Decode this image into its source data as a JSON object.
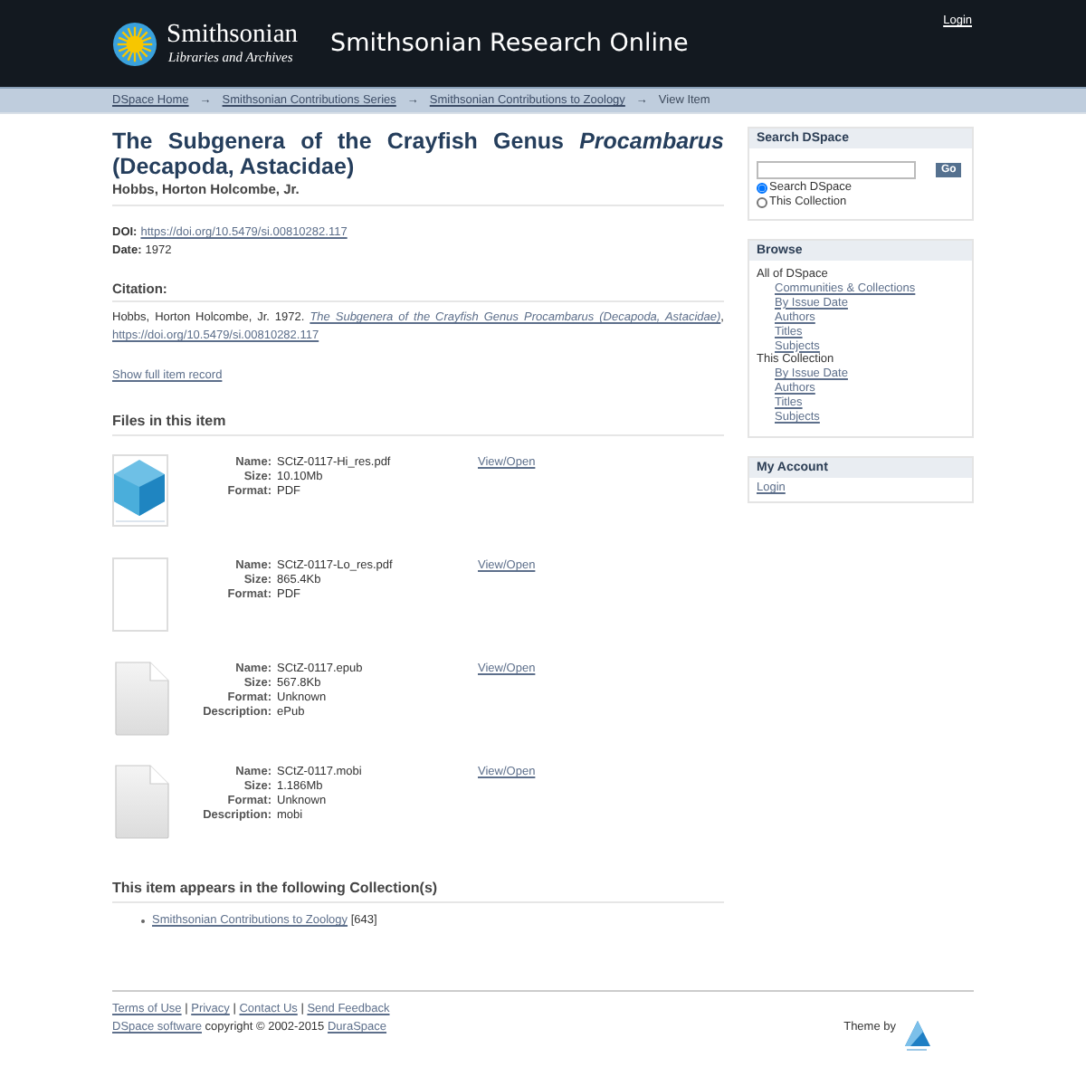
{
  "header": {
    "logo_name": "Smithsonian",
    "logo_subtitle": "Libraries and Archives",
    "site_title": "Smithsonian Research Online",
    "login": "Login"
  },
  "breadcrumbs": [
    {
      "label": "DSpace Home",
      "link": true
    },
    {
      "label": "Smithsonian Contributions Series",
      "link": true,
      "separator": "→"
    },
    {
      "label": "Smithsonian Contributions to Zoology",
      "link": true,
      "separator": "→"
    },
    {
      "label": "View Item",
      "link": false,
      "separator": "→"
    }
  ],
  "item": {
    "title": "The Subgenera of the Crayfish Genus *Procambarus* (Decapoda, Astacidae)",
    "author": "Hobbs, Horton Holcombe, Jr.",
    "fields": [
      {
        "label": "DOI:",
        "value": "https://doi.org/10.5479/si.00810282.117",
        "kind": "link"
      },
      {
        "label": "Date:",
        "value": "1972",
        "kind": "text"
      }
    ],
    "citation_heading": "Citation:",
    "citation": [
      {
        "kind": "text",
        "text": "Hobbs, Horton Holcombe, Jr. 1972. "
      },
      {
        "kind": "title_link",
        "text": "The Subgenera of the Crayfish Genus Procambarus (Decapoda, Astacidae)"
      },
      {
        "kind": "text",
        "text": ", "
      },
      {
        "kind": "link",
        "text": "https://doi.org/10.5479/si.00810282.117"
      }
    ],
    "full_record": "Show full item record",
    "files_heading": "Files in this item",
    "files": [
      {
        "kind": "cube",
        "rows": [
          {
            "label": "Name:",
            "value": "SCtZ-0117-Hi_res.pdf"
          },
          {
            "label": "Size:",
            "value": "10.10Mb"
          },
          {
            "label": "Format:",
            "value": "PDF"
          }
        ],
        "link": "View/Open"
      },
      {
        "kind": "blank",
        "rows": [
          {
            "label": "Name:",
            "value": "SCtZ-0117-Lo_res.pdf"
          },
          {
            "label": "Size:",
            "value": "865.4Kb"
          },
          {
            "label": "Format:",
            "value": "PDF"
          }
        ],
        "link": "View/Open"
      },
      {
        "kind": "generic",
        "rows": [
          {
            "label": "Name:",
            "value": "SCtZ-0117.epub"
          },
          {
            "label": "Size:",
            "value": "567.8Kb"
          },
          {
            "label": "Format:",
            "value": "Unknown"
          },
          {
            "label": "Description:",
            "value": "ePub"
          }
        ],
        "link": "View/Open"
      },
      {
        "kind": "generic",
        "rows": [
          {
            "label": "Name:",
            "value": "SCtZ-0117.mobi"
          },
          {
            "label": "Size:",
            "value": "1.186Mb"
          },
          {
            "label": "Format:",
            "value": "Unknown"
          },
          {
            "label": "Description:",
            "value": "mobi"
          }
        ],
        "link": "View/Open"
      }
    ],
    "collections_heading": "This item appears in the following Collection(s)",
    "collections": [
      {
        "link": "Smithsonian Contributions to Zoology",
        "count": "[643]"
      }
    ]
  },
  "sidebar": {
    "search": {
      "title": "Search DSpace",
      "button": "Go",
      "options": [
        {
          "label": "Search DSpace",
          "selected": true
        },
        {
          "label": "This Collection",
          "selected": false
        }
      ]
    },
    "browse": {
      "title": "Browse",
      "groups": [
        {
          "heading": "All of DSpace",
          "links": [
            "Communities & Collections",
            "By Issue Date",
            "Authors",
            "Titles",
            "Subjects"
          ]
        },
        {
          "heading": "This Collection",
          "links": [
            "By Issue Date",
            "Authors",
            "Titles",
            "Subjects"
          ]
        }
      ]
    },
    "account": {
      "title": "My Account",
      "links": [
        "Login"
      ]
    }
  },
  "footer": {
    "line_1": [
      {
        "kind": "link",
        "text": "Terms of Use"
      },
      {
        "kind": "text",
        "text": " | "
      },
      {
        "kind": "link",
        "text": "Privacy"
      },
      {
        "kind": "text",
        "text": " | "
      },
      {
        "kind": "link",
        "text": "Contact Us"
      },
      {
        "kind": "text",
        "text": " | "
      },
      {
        "kind": "link",
        "text": "Send Feedback"
      }
    ],
    "line_2": [
      {
        "kind": "link",
        "text": "DSpace software"
      },
      {
        "kind": "text",
        "text": " copyright © 2002-2015 "
      },
      {
        "kind": "link",
        "text": "DuraSpace"
      }
    ],
    "theme_by": "Theme by"
  }
}
